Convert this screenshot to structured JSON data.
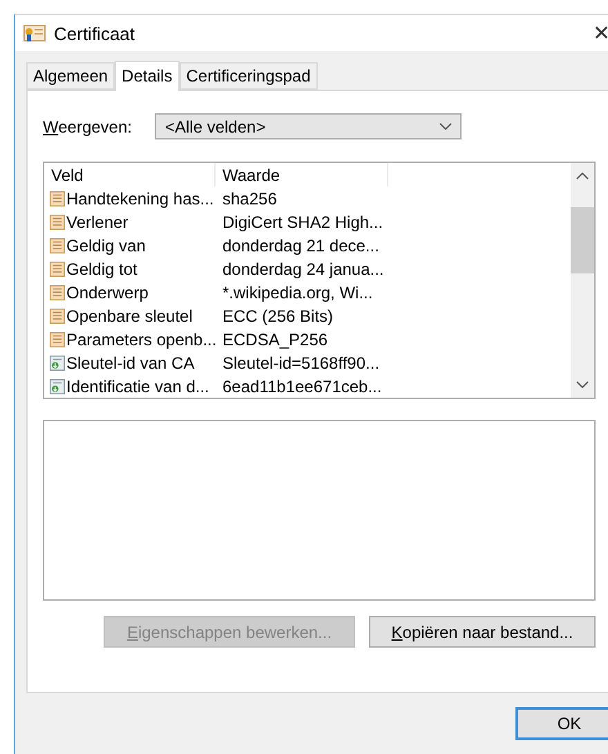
{
  "window": {
    "title": "Certificaat",
    "close": "✕"
  },
  "tabs": [
    {
      "label": "Algemeen",
      "selected": false
    },
    {
      "label": "Details",
      "selected": true
    },
    {
      "label": "Certificeringspad",
      "selected": false
    }
  ],
  "show": {
    "label": {
      "accel": "W",
      "rest": "eergeven:"
    },
    "value": "<Alle velden>"
  },
  "table": {
    "columns": [
      "Veld",
      "Waarde"
    ],
    "rows": [
      {
        "kind": "field",
        "field": "Handtekening has...",
        "value": "sha256",
        "selected": false
      },
      {
        "kind": "field",
        "field": "Verlener",
        "value": "DigiCert SHA2 High...",
        "selected": false
      },
      {
        "kind": "field",
        "field": "Geldig van",
        "value": "donderdag 21 dece...",
        "selected": false
      },
      {
        "kind": "field",
        "field": "Geldig tot",
        "value": "donderdag 24 janua...",
        "selected": false
      },
      {
        "kind": "field",
        "field": "Onderwerp",
        "value": "*.wikipedia.org, Wi...",
        "selected": false
      },
      {
        "kind": "field",
        "field": "Openbare sleutel",
        "value": "ECC (256 Bits)",
        "selected": false
      },
      {
        "kind": "field",
        "field": "Parameters openb...",
        "value": "ECDSA_P256",
        "selected": false
      },
      {
        "kind": "extension",
        "field": "Sleutel-id van CA",
        "value": "Sleutel-id=5168ff90...",
        "selected": false
      },
      {
        "kind": "extension",
        "field": "Identificatie van d...",
        "value": "6ead11b1ee671ceb...",
        "selected": false
      }
    ]
  },
  "buttons": [
    {
      "accel": "E",
      "rest": "igenschappen bewerken...",
      "disabled": true
    },
    {
      "accel": "K",
      "rest": "opiëren naar bestand...",
      "disabled": false
    }
  ],
  "ok": {
    "label": "OK"
  }
}
